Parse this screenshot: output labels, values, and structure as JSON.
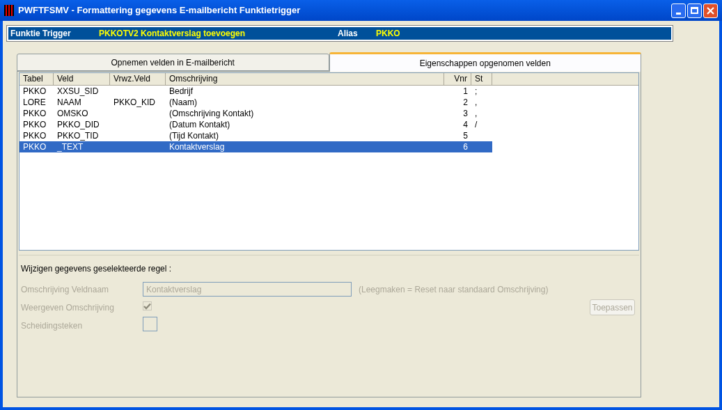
{
  "window": {
    "title": "PWFTFSMV - Formattering gegevens E-mailbericht Funktietrigger"
  },
  "header": {
    "label": "Funktie Trigger",
    "value": "PKKOTV2  Kontaktverslag toevoegen",
    "alias_label": "Alias",
    "alias_value": "PKKO"
  },
  "tabs": [
    {
      "label": "Opnemen velden in E-mailbericht",
      "selected": false
    },
    {
      "label": "Eigenschappen opgenomen velden",
      "selected": true
    }
  ],
  "table": {
    "columns": [
      "Tabel",
      "Veld",
      "Vrwz.Veld",
      "Omschrijving",
      "Vnr",
      "St"
    ],
    "rows": [
      {
        "cells": [
          "PKKO",
          "XXSU_SID",
          "",
          "Bedrijf",
          "1",
          ";"
        ],
        "selected": false
      },
      {
        "cells": [
          "LORE",
          "NAAM",
          "PKKO_KID",
          "(Naam)",
          "2",
          ","
        ],
        "selected": false
      },
      {
        "cells": [
          "PKKO",
          "OMSKO",
          "",
          "(Omschrijving Kontakt)",
          "3",
          ","
        ],
        "selected": false
      },
      {
        "cells": [
          "PKKO",
          "PKKO_DID",
          "",
          "(Datum Kontakt)",
          "4",
          "/"
        ],
        "selected": false
      },
      {
        "cells": [
          "PKKO",
          "PKKO_TID",
          "",
          "(Tijd Kontakt)",
          "5",
          ""
        ],
        "selected": false
      },
      {
        "cells": [
          "PKKO",
          "_TEXT",
          "",
          "Kontaktverslag",
          "6",
          ""
        ],
        "selected": true
      }
    ]
  },
  "edit": {
    "title": "Wijzigen gegevens geselekteerde regel :",
    "description": {
      "label": "Omschrijving Veldnaam",
      "value": "Kontaktverslag",
      "hint": "(Leegmaken = Reset naar standaard Omschrijving)",
      "disabled": true
    },
    "show_description": {
      "label": "Weergeven Omschrijving",
      "checked": true,
      "disabled": true
    },
    "separator": {
      "label": "Scheidingsteken",
      "disabled": true
    },
    "apply_button": {
      "label": "Toepassen",
      "disabled": true
    }
  }
}
